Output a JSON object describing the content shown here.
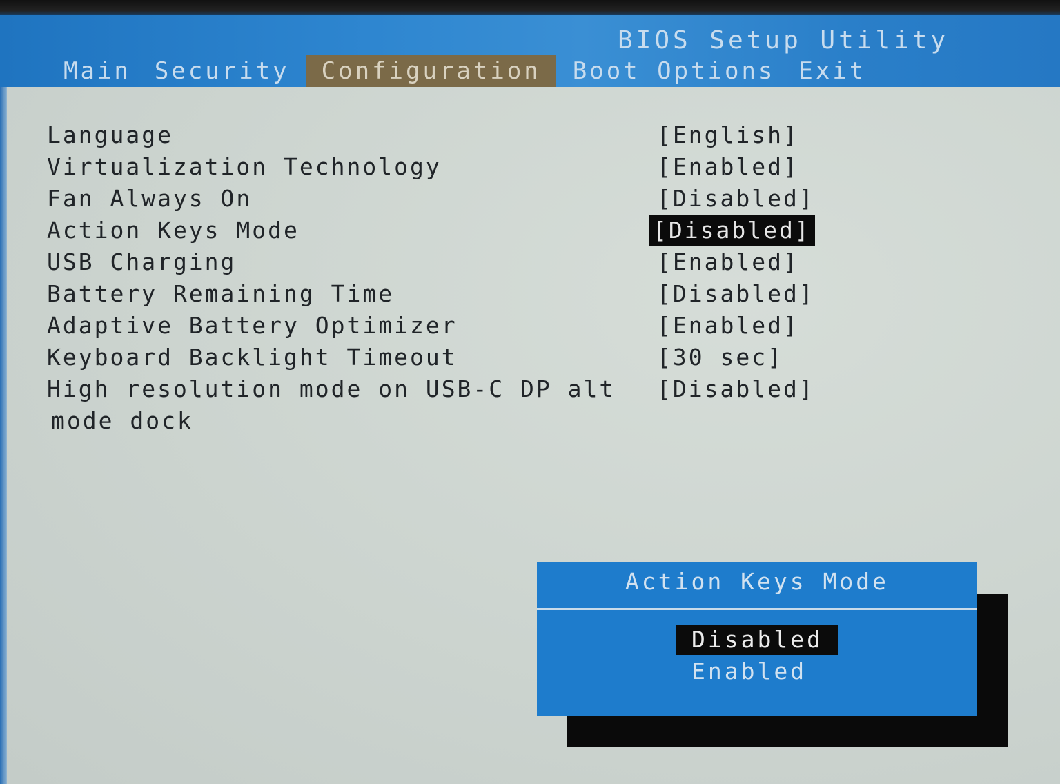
{
  "header": {
    "title": "BIOS Setup Utility"
  },
  "menu": [
    {
      "label": "Main"
    },
    {
      "label": "Security"
    },
    {
      "label": "Configuration"
    },
    {
      "label": "Boot Options"
    },
    {
      "label": "Exit"
    }
  ],
  "active_menu": "Configuration",
  "settings": [
    {
      "label": "Language",
      "value": "[English]"
    },
    {
      "label": "Virtualization Technology",
      "value": "[Enabled]"
    },
    {
      "label": "Fan Always On",
      "value": "[Disabled]"
    },
    {
      "label": "Action Keys Mode",
      "value": "[Disabled]"
    },
    {
      "label": "USB Charging",
      "value": "[Enabled]"
    },
    {
      "label": "Battery Remaining Time",
      "value": "[Disabled]"
    },
    {
      "label": "Adaptive Battery Optimizer",
      "value": "[Enabled]"
    },
    {
      "label": "Keyboard Backlight Timeout",
      "value": "[30 sec]"
    },
    {
      "label": "High resolution mode on USB-C DP alt",
      "label_cont": "mode dock",
      "value": "[Disabled]"
    }
  ],
  "selected_setting": "Action Keys Mode",
  "popup": {
    "title": "Action Keys Mode",
    "options": [
      "Disabled",
      "Enabled"
    ],
    "selected": "Disabled"
  },
  "colors": {
    "header_blue": "#2a7fc9",
    "active_tab": "#7b6a48",
    "content_bg": "#cdd5d0",
    "popup_blue": "#1e7ccc",
    "highlight": "#0b0b0b"
  }
}
